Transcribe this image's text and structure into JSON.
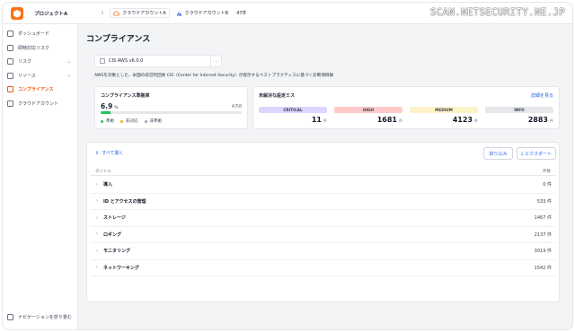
{
  "topbar": {
    "project": "プロジェクトA",
    "switch_icon": "updown-arrows-icon",
    "account_a": "クラウドアカウントA",
    "account_b": "クラウドアカウントB",
    "count": "47件",
    "watermark": "SCAN.NETSECURITY.NE.JP"
  },
  "sidebar": {
    "items": [
      {
        "label": "ダッシュボード"
      },
      {
        "label": "即時対応リスク"
      },
      {
        "label": "リスク"
      },
      {
        "label": "リソース"
      },
      {
        "label": "コンプライアンス"
      },
      {
        "label": "クラウドアカウント"
      }
    ],
    "collapse_label": "ナビゲーションを折り畳む"
  },
  "main": {
    "title": "コンプライアンス",
    "benchmark": "CIS AWS v6.0.0",
    "description": "AWSを対象とした、米国の非営利団体 CIS（Center for Internet Security）が提示するベストプラクティスに基づく診断項目群"
  },
  "compliance_rate": {
    "title": "コンプライアンス準拠率",
    "value": "6.9",
    "unit": "%",
    "fraction": "4/58",
    "progress": 0.069,
    "legend": [
      "準拠",
      "非対応",
      "非準拠"
    ],
    "legend_colors": [
      "#22c55e",
      "#eab308",
      "#9ca3af"
    ]
  },
  "unresolved": {
    "title": "未解決な設定ミス",
    "link": "詳細を見る",
    "unit": "件",
    "levels": [
      {
        "name": "CRITICAL",
        "value": "11",
        "color": "#ddd6fe"
      },
      {
        "name": "HIGH",
        "value": "1681",
        "color": "#fecaca"
      },
      {
        "name": "MEDIUM",
        "value": "4123",
        "color": "#fef3c7"
      },
      {
        "name": "INFO",
        "value": "2883",
        "color": "#e5e7eb"
      }
    ]
  },
  "table": {
    "expand_all": "すべて開く",
    "filter": "絞り込み",
    "export": "エクスポート",
    "col_title": "タイトル",
    "col_count": "件数",
    "rows": [
      {
        "title": "導入",
        "count": "0 件"
      },
      {
        "title": "ID とアクセスの管理",
        "count": "533 件"
      },
      {
        "title": "ストレージ",
        "count": "1467 件"
      },
      {
        "title": "ロギング",
        "count": "2137 件"
      },
      {
        "title": "モニタリング",
        "count": "3019 件"
      },
      {
        "title": "ネットワーキング",
        "count": "1542 件"
      }
    ]
  }
}
